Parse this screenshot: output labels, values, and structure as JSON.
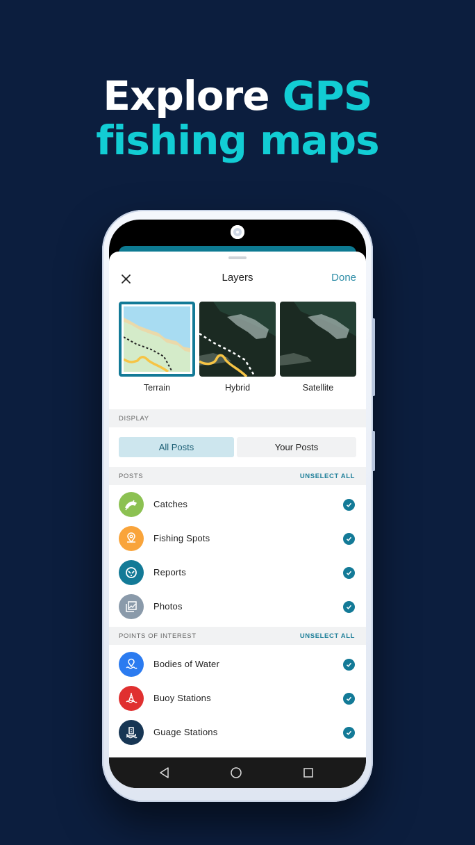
{
  "headline": {
    "line1_white": "Explore ",
    "line1_cyan": "GPS",
    "line2_cyan": "fishing maps"
  },
  "colors": {
    "background": "#0c1e3e",
    "accent_cyan": "#12cdd4",
    "brand_teal": "#137a97",
    "done_link": "#2c8ca6"
  },
  "sheet": {
    "title": "Layers",
    "close_icon": "close-icon",
    "done_label": "Done"
  },
  "map_layers": [
    {
      "label": "Terrain",
      "selected": true
    },
    {
      "label": "Hybrid",
      "selected": false
    },
    {
      "label": "Satellite",
      "selected": false
    }
  ],
  "display": {
    "header": "DISPLAY",
    "options": [
      {
        "label": "All Posts",
        "selected": true
      },
      {
        "label": "Your Posts",
        "selected": false
      }
    ]
  },
  "posts": {
    "header": "POSTS",
    "action": "UNSELECT ALL",
    "items": [
      {
        "label": "Catches",
        "icon": "fish-icon",
        "color": "#8cc152",
        "checked": true
      },
      {
        "label": "Fishing Spots",
        "icon": "location-pin-icon",
        "color": "#f9a43b",
        "checked": true
      },
      {
        "label": "Reports",
        "icon": "report-icon",
        "color": "#137a97",
        "checked": true
      },
      {
        "label": "Photos",
        "icon": "photos-icon",
        "color": "#8a9aaa",
        "checked": true
      }
    ]
  },
  "poi": {
    "header": "POINTS OF INTEREST",
    "action": "UNSELECT ALL",
    "items": [
      {
        "label": "Bodies of Water",
        "icon": "water-pin-icon",
        "color": "#2b7bf0",
        "checked": true
      },
      {
        "label": "Buoy Stations",
        "icon": "buoy-icon",
        "color": "#e03030",
        "checked": true
      },
      {
        "label": "Guage Stations",
        "icon": "gauge-station-icon",
        "color": "#173654",
        "checked": true
      }
    ]
  },
  "navbar": {
    "back": "back-icon",
    "home": "home-icon",
    "recents": "recents-icon"
  }
}
